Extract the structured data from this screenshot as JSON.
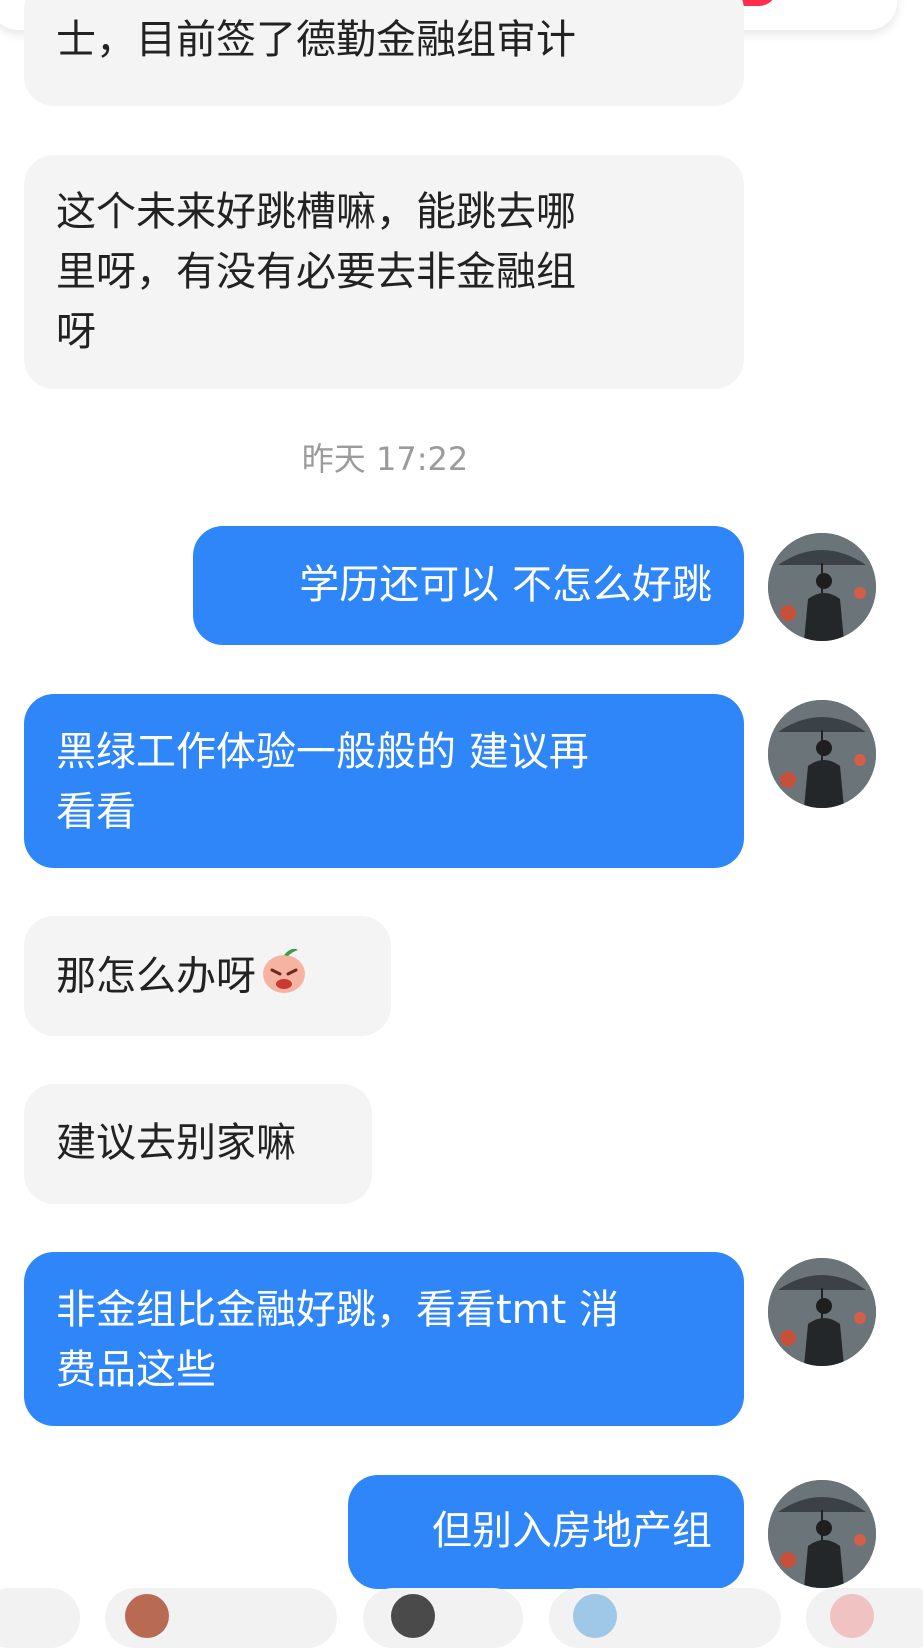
{
  "messages": [
    {
      "side": "in",
      "text": "士，目前签了德勤金融组审计"
    },
    {
      "side": "in",
      "text": "这个未来好跳槽嘛，能跳去哪\n里呀，有没有必要去非金融组\n呀"
    },
    {
      "side": "out",
      "text": "学历还可以 不怎么好跳"
    },
    {
      "side": "out",
      "text": "黑绿工作体验一般般的 建议再\n看看"
    },
    {
      "side": "in",
      "text": "那怎么办呀",
      "emoji": "crying-peach-emoji"
    },
    {
      "side": "in",
      "text": "建议去别家嘛"
    },
    {
      "side": "out",
      "text": "非金组比金融好跳，看看tmt 消\n费品这些"
    },
    {
      "side": "out",
      "text": "但别入房地产组"
    }
  ],
  "timestamp": "昨天 17:22",
  "avatar": {
    "description": "man-with-umbrella-avatar"
  },
  "colors": {
    "outgoing_bubble": "#2e86f8",
    "incoming_bubble": "#f4f4f4",
    "accent_red": "#ff2e4d"
  }
}
